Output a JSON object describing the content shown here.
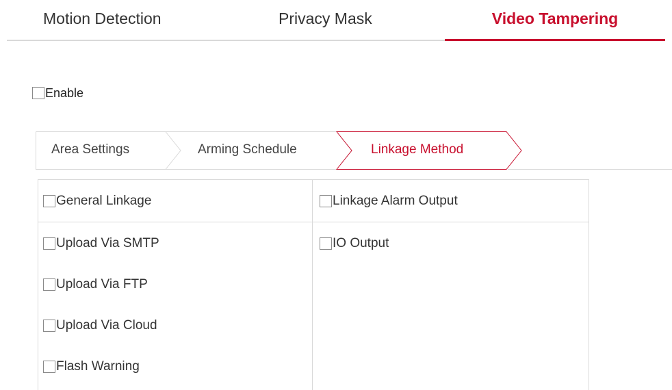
{
  "top_tabs": [
    {
      "label": "Motion Detection",
      "active": false
    },
    {
      "label": "Privacy Mask",
      "active": false
    },
    {
      "label": "Video Tampering",
      "active": true
    }
  ],
  "enable": {
    "label": "Enable",
    "checked": false
  },
  "sub_tabs": [
    {
      "label": "Area Settings",
      "active": false
    },
    {
      "label": "Arming Schedule",
      "active": false
    },
    {
      "label": "Linkage Method",
      "active": true
    }
  ],
  "linkage": {
    "general": {
      "header": "General Linkage",
      "items": [
        "Upload Via SMTP",
        "Upload Via FTP",
        "Upload Via Cloud",
        "Flash Warning"
      ]
    },
    "alarm_output": {
      "header": "Linkage Alarm Output",
      "items": [
        "IO Output"
      ]
    }
  },
  "colors": {
    "accent": "#c8102e",
    "border": "#d9d9d9",
    "text": "#333333"
  }
}
